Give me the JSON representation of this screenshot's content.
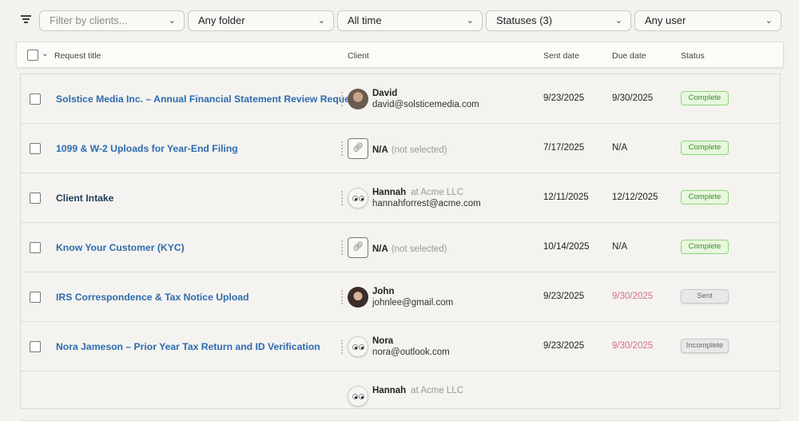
{
  "filters": {
    "clients_placeholder": "Filter by clients...",
    "folder": "Any folder",
    "time": "All time",
    "statuses": "Statuses (3)",
    "user": "Any user"
  },
  "columns": {
    "title": "Request title",
    "client": "Client",
    "sent": "Sent date",
    "due": "Due date",
    "status": "Status"
  },
  "rows": [
    {
      "title": "Solstice Media Inc. – Annual Financial Statement Review Request",
      "client_name": "David",
      "client_email": "david@solsticemedia.com",
      "sent": "9/23/2025",
      "due": "9/30/2025",
      "status": "Complete"
    },
    {
      "title": "1099 & W-2 Uploads for Year-End Filing",
      "client_name": "N/A",
      "client_note": "(not selected)",
      "sent": "7/17/2025",
      "due": "N/A",
      "status": "Complete"
    },
    {
      "title": "Client Intake",
      "client_name": "Hannah",
      "client_org": "at Acme LLC",
      "client_email": "hannahforrest@acme.com",
      "sent": "12/11/2025",
      "due": "12/12/2025",
      "status": "Complete"
    },
    {
      "title": "Know Your Customer (KYC)",
      "client_name": "N/A",
      "client_note": "(not selected)",
      "sent": "10/14/2025",
      "due": "N/A",
      "status": "Complete"
    },
    {
      "title": "IRS Correspondence & Tax Notice Upload",
      "client_name": "John",
      "client_email": "johnlee@gmail.com",
      "sent": "9/23/2025",
      "due": "9/30/2025",
      "status": "Sent"
    },
    {
      "title": "Nora Jameson – Prior Year Tax Return and ID Verification",
      "client_name": "Nora",
      "client_email": "nora@outlook.com",
      "sent": "9/23/2025",
      "due": "9/30/2025",
      "status": "Incomplete"
    },
    {
      "client_name": "Hannah",
      "client_org": "at Acme LLC"
    }
  ]
}
